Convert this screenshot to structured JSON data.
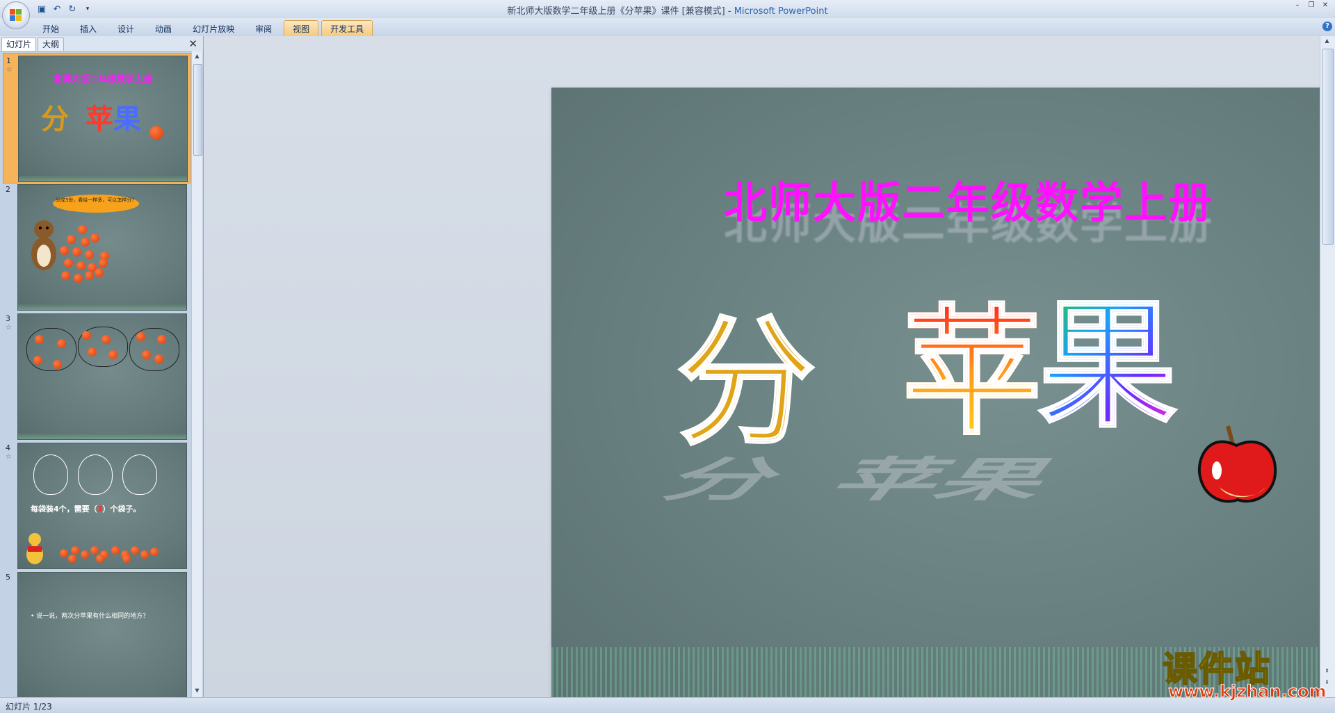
{
  "titlebar": {
    "doc_title": "新北师大版数学二年级上册《分苹果》课件 [兼容模式]",
    "separator": " - ",
    "app_name": "Microsoft PowerPoint"
  },
  "ribbon": {
    "tabs": [
      "开始",
      "插入",
      "设计",
      "动画",
      "幻灯片放映",
      "审阅",
      "视图",
      "开发工具"
    ],
    "active_tab": "视图"
  },
  "panel": {
    "tabs": [
      "幻灯片",
      "大纲"
    ],
    "close_glyph": "✕"
  },
  "thumbnails": [
    {
      "number": "1",
      "title": "北师大版二年级数学上册",
      "chars": [
        "分",
        "苹",
        "果"
      ],
      "selected": true
    },
    {
      "number": "2",
      "bubble": "分成3份，看给一样多，可以怎样分？"
    },
    {
      "number": "3"
    },
    {
      "number": "4",
      "text_prefix": "每袋装4个，需要（",
      "text_answer": "3",
      "text_suffix": "）个袋子。"
    },
    {
      "number": "5",
      "text": "• 说一说，两次分苹果有什么相同的地方？"
    }
  ],
  "slide": {
    "title": "北师大版二年级数学上册",
    "chars": [
      "分",
      "苹",
      "果"
    ]
  },
  "status": {
    "slide_indicator": "幻灯片 1/23"
  },
  "watermark": {
    "name": "课件站",
    "url": "www.kjzhan.com"
  },
  "colors": {
    "slide_bg": "#6b8282",
    "title_magenta": "#ff10ff",
    "selected_thumb": "#f6b35a"
  }
}
